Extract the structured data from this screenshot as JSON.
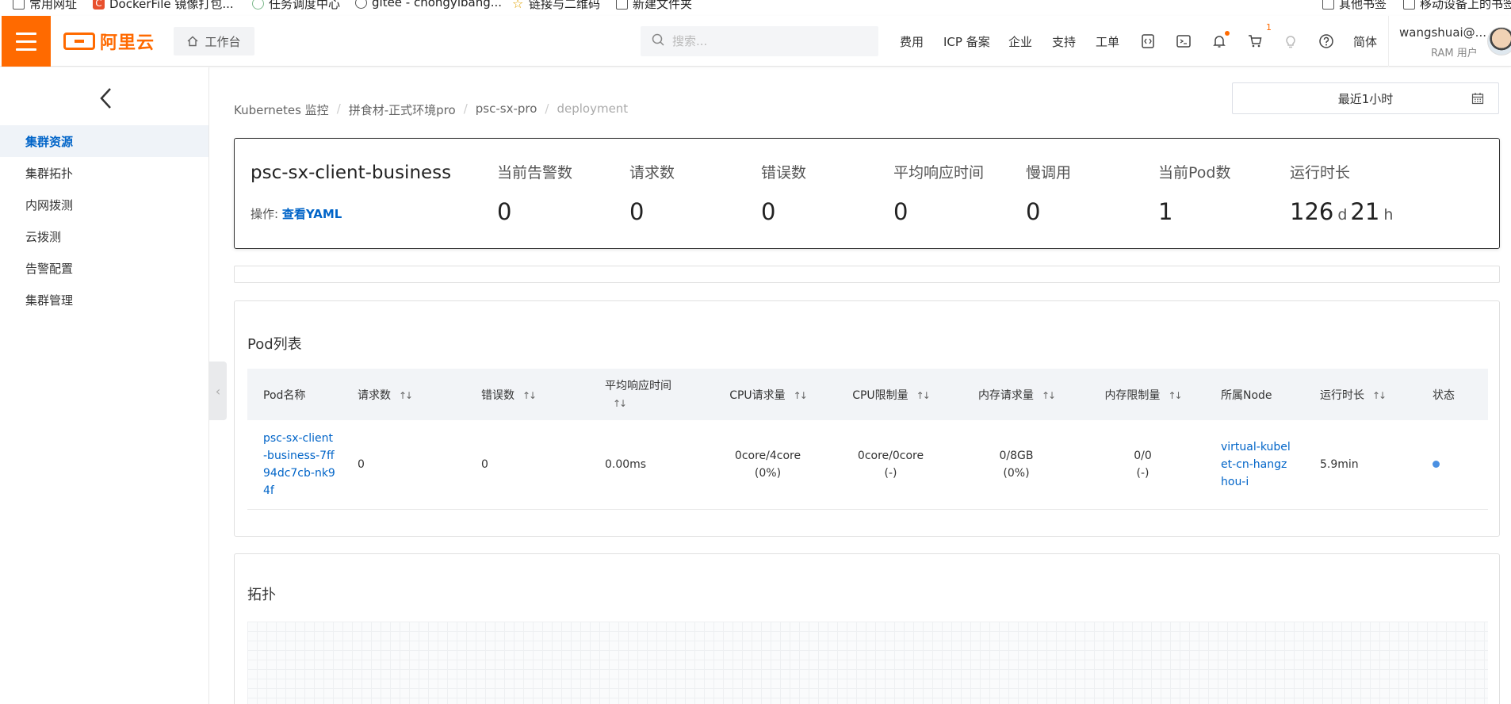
{
  "bookmarks": [
    {
      "label": "常用网址",
      "icon": "folder-icon"
    },
    {
      "label": "DockerFile 镜像打包...",
      "icon": "docker-icon"
    },
    {
      "label": "任务调度中心",
      "icon": "task-icon"
    },
    {
      "label": "gitee - chongyibang...",
      "icon": "globe-icon"
    },
    {
      "label": "链接与二维码",
      "icon": "star-icon"
    },
    {
      "label": "新建文件夹",
      "icon": "folder-icon"
    },
    {
      "label": "其他书签",
      "icon": "folder-icon"
    },
    {
      "label": "移动设备上的书签",
      "icon": "phone-icon"
    }
  ],
  "header": {
    "logo": "阿里云",
    "workbench": "工作台",
    "search_placeholder": "搜索...",
    "links": [
      "费用",
      "ICP 备案",
      "企业",
      "支持",
      "工单"
    ],
    "cart_count": "1",
    "lang": "简体",
    "user_name": "wangshuai@...",
    "user_role": "RAM 用户",
    "accent_color": "#ff6a00"
  },
  "sidebar": {
    "items": [
      {
        "label": "集群资源",
        "active": true
      },
      {
        "label": "集群拓扑",
        "active": false
      },
      {
        "label": "内网拨测",
        "active": false
      },
      {
        "label": "云拨测",
        "active": false
      },
      {
        "label": "告警配置",
        "active": false
      },
      {
        "label": "集群管理",
        "active": false
      }
    ]
  },
  "breadcrumb": [
    "Kubernetes 监控",
    "拼食材-正式环境pro",
    "psc-sx-pro",
    "deployment"
  ],
  "time_range": "最近1小时",
  "summary": {
    "name": "psc-sx-client-business",
    "ops_label": "操作:",
    "ops_link": "查看YAML",
    "metrics": [
      {
        "label": "当前告警数",
        "value": "0"
      },
      {
        "label": "请求数",
        "value": "0"
      },
      {
        "label": "错误数",
        "value": "0"
      },
      {
        "label": "平均响应时间",
        "value": "0"
      },
      {
        "label": "慢调用",
        "value": "0"
      },
      {
        "label": "当前Pod数",
        "value": "1"
      }
    ],
    "uptime": {
      "label": "运行时长",
      "days": "126",
      "day_unit": "d",
      "hours": "21",
      "hour_unit": "h"
    }
  },
  "pod_list": {
    "title": "Pod列表",
    "headers": [
      "Pod名称",
      "请求数",
      "错误数",
      "平均响应时间",
      "CPU请求量",
      "CPU限制量",
      "内存请求量",
      "内存限制量",
      "所属Node",
      "运行时长",
      "状态"
    ],
    "sort_glyph": "↑↓",
    "rows": [
      {
        "pod_name": "psc-sx-client-business-7ff94dc7cb-nk94f",
        "pod_name_lines": [
          "psc-sx-client",
          "-business-7ff",
          "94dc7cb-nk9",
          "4f"
        ],
        "requests": "0",
        "errors": "0",
        "avg_rt": "0.00ms",
        "cpu_req": "0core/4core",
        "cpu_req_pct": "(0%)",
        "cpu_limit": "0core/0core",
        "cpu_limit_pct": "(-)",
        "mem_req": "0/8GB",
        "mem_req_pct": "(0%)",
        "mem_limit": "0/0",
        "mem_limit_pct": "(-)",
        "node_lines": [
          "virtual-kubel",
          "et-cn-hangz",
          "hou-i"
        ],
        "uptime": "5.9min",
        "status_color": "#4a90e2"
      }
    ]
  },
  "topology": {
    "title": "拓扑"
  }
}
